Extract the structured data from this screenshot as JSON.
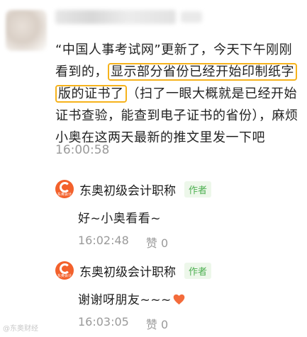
{
  "comment": {
    "text_before": "“中国人事考试网”更新了，今天下午刚刚看到的，",
    "highlight_1": "显示部分省份已经开始印制纸字",
    "highlight_2": "版的证书了",
    "text_after": "（扫了一眼大概就是已经开始证书查验，能查到电子证书的省份），麻烦小奥在这两天最新的推文里发一下吧",
    "time": "16:00:58"
  },
  "replies": [
    {
      "author": "东奥初级会计职称",
      "badge": "作者",
      "text": "好~小奥看看~",
      "time": "16:02:48",
      "likes": "赞 0"
    },
    {
      "author": "东奥初级会计职称",
      "badge": "作者",
      "text": "谢谢呀朋友~~~",
      "time": "16:03:05",
      "likes": "赞 0"
    }
  ],
  "logo_text": "东奥会计",
  "watermark": "@东奥财经",
  "colors": {
    "highlight_border": "#f6b21b",
    "logo": "#f3612c",
    "badge_text": "#4caf50",
    "badge_bg": "#edf7ea",
    "time": "#9a9a9a"
  }
}
